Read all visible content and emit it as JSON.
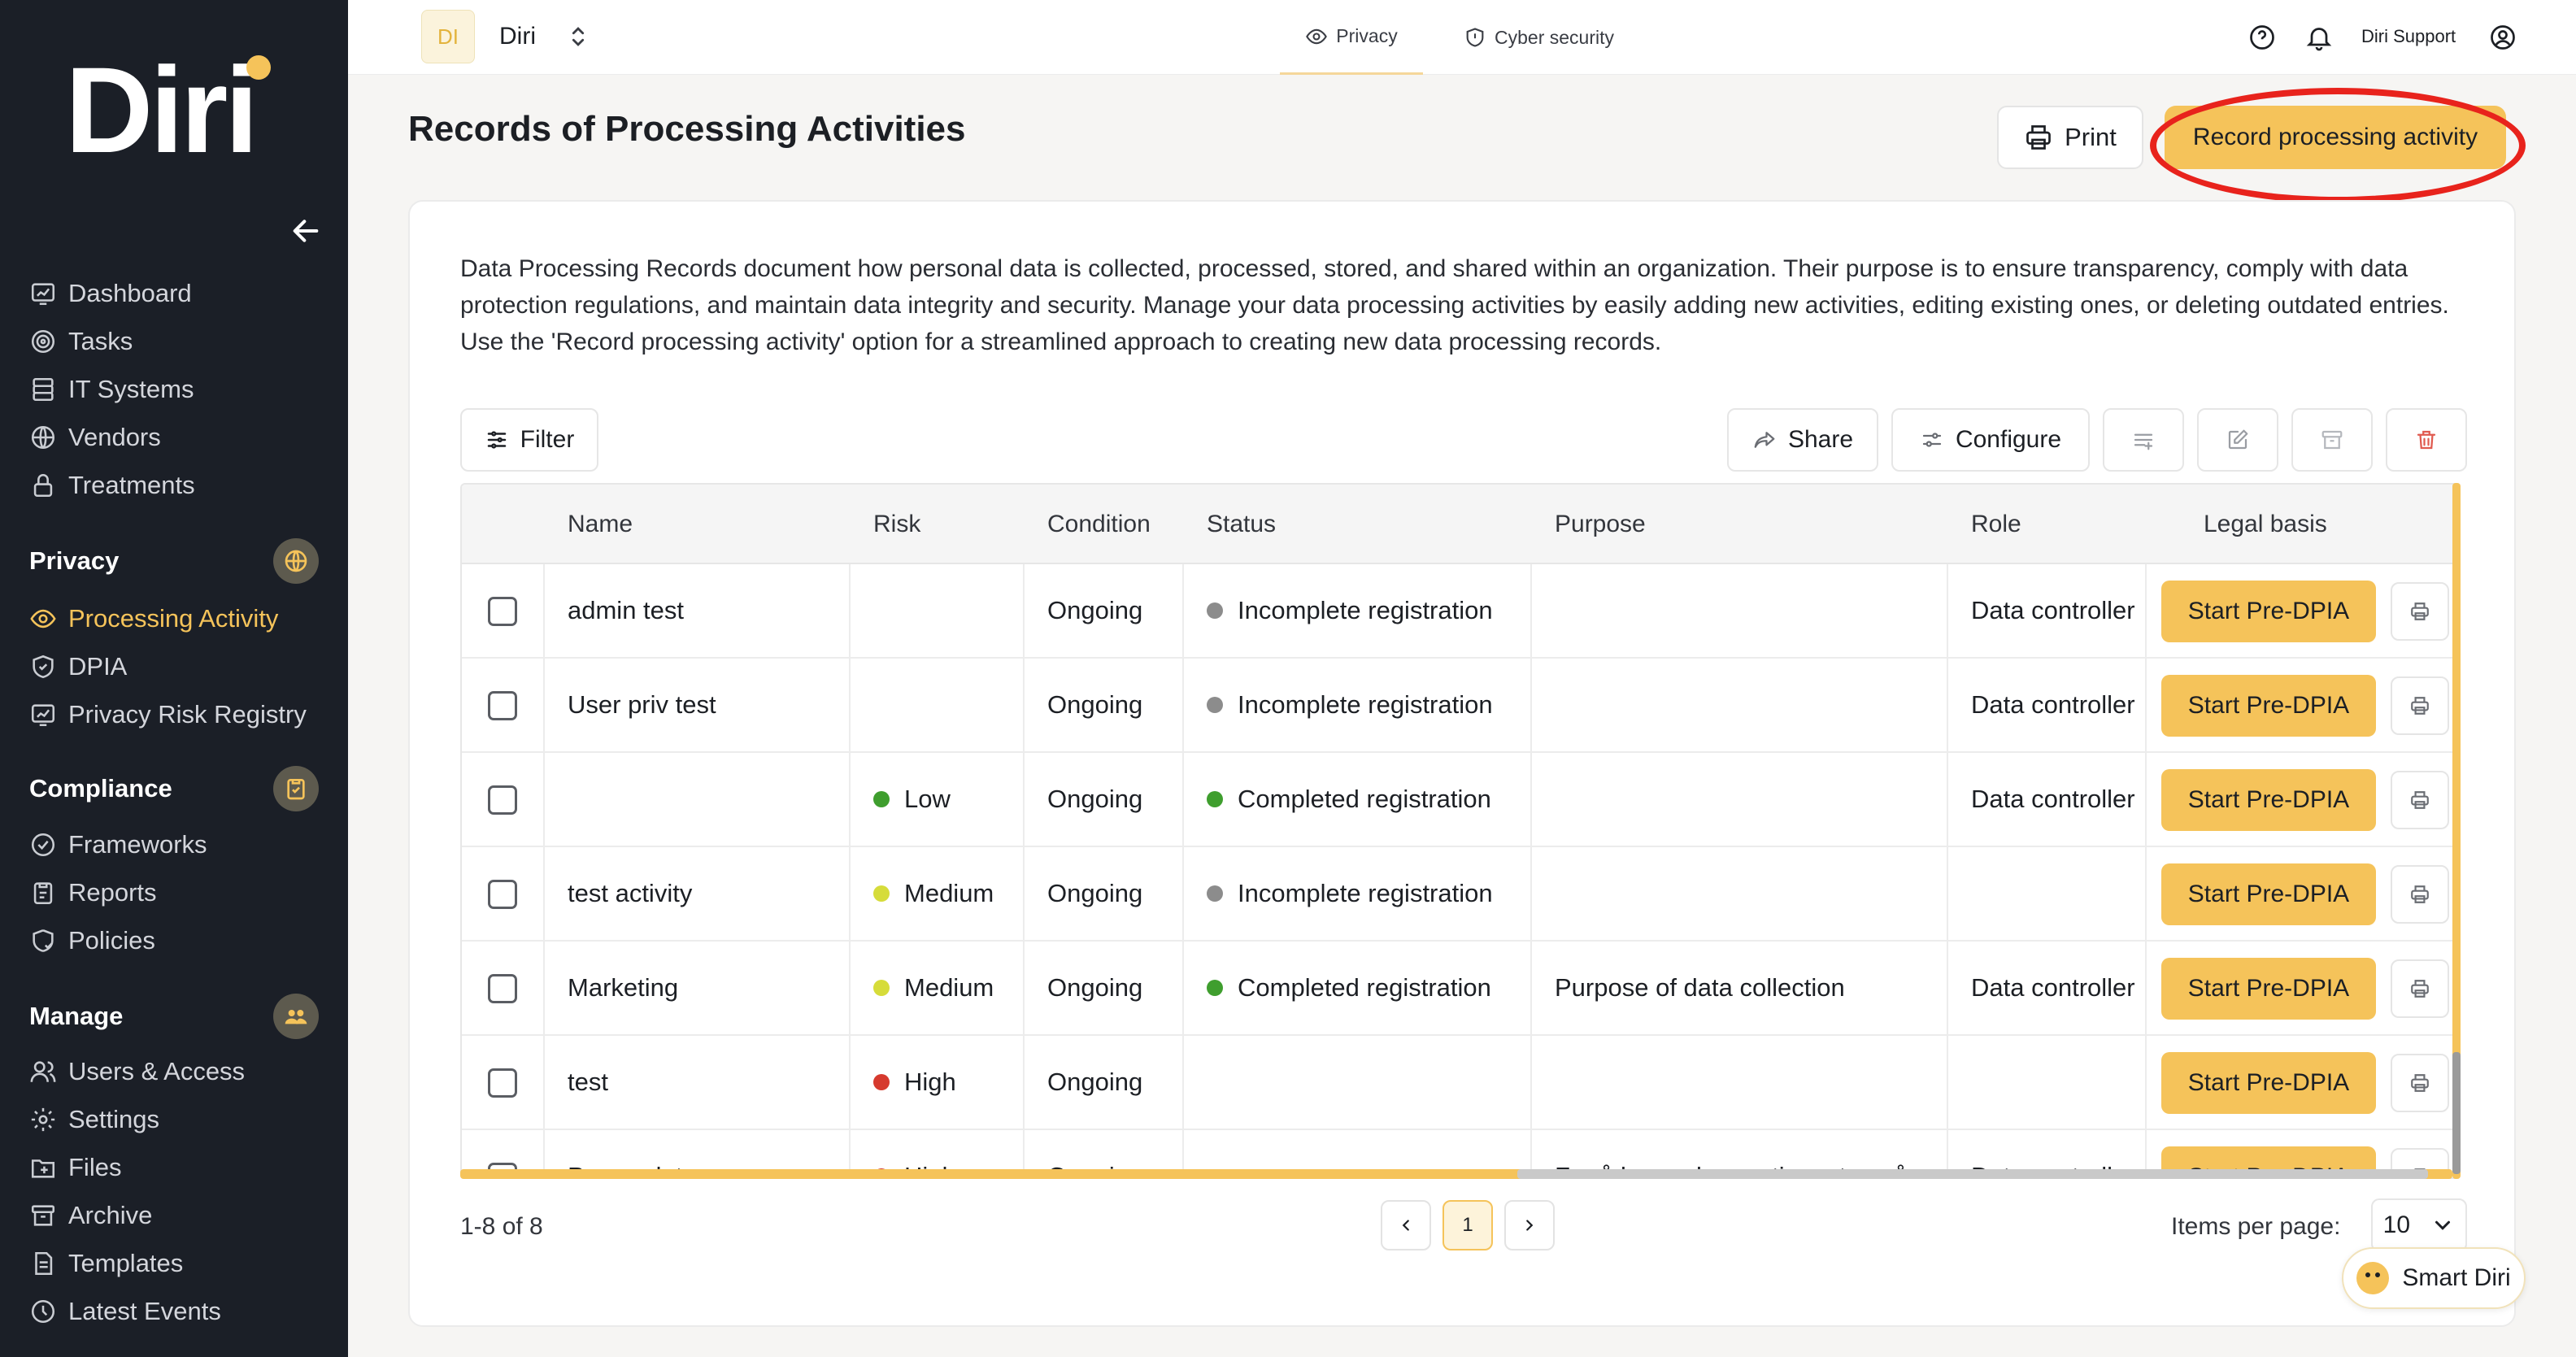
{
  "brand": {
    "logo": "Diri",
    "accent": "#f5c35a",
    "sidebar_bg": "#1b1f27"
  },
  "topbar": {
    "org_initials": "DI",
    "org_name": "Diri",
    "tabs": [
      {
        "label": "Privacy",
        "icon": "eye-icon",
        "active": true
      },
      {
        "label": "Cyber security",
        "icon": "shield-icon",
        "active": false
      }
    ],
    "user_name": "Diri Support"
  },
  "sidebar": {
    "top_items": [
      {
        "label": "Dashboard",
        "icon": "dashboard-icon"
      },
      {
        "label": "Tasks",
        "icon": "target-icon"
      },
      {
        "label": "IT Systems",
        "icon": "server-icon"
      },
      {
        "label": "Vendors",
        "icon": "globe-icon"
      },
      {
        "label": "Treatments",
        "icon": "lock-icon"
      }
    ],
    "privacy_section": "Privacy",
    "privacy_items": [
      {
        "label": "Processing Activity",
        "icon": "eye-icon",
        "active": true
      },
      {
        "label": "DPIA",
        "icon": "shield-icon"
      },
      {
        "label": "Privacy Risk Registry",
        "icon": "registry-icon"
      }
    ],
    "compliance_section": "Compliance",
    "compliance_items": [
      {
        "label": "Frameworks",
        "icon": "check-circle-icon"
      },
      {
        "label": "Reports",
        "icon": "clipboard-icon"
      },
      {
        "label": "Policies",
        "icon": "policy-icon"
      }
    ],
    "manage_section": "Manage",
    "manage_items": [
      {
        "label": "Users & Access",
        "icon": "users-icon"
      },
      {
        "label": "Settings",
        "icon": "gear-icon"
      },
      {
        "label": "Files",
        "icon": "files-icon"
      },
      {
        "label": "Archive",
        "icon": "archive-icon"
      },
      {
        "label": "Templates",
        "icon": "templates-icon"
      },
      {
        "label": "Latest Events",
        "icon": "clock-icon"
      }
    ]
  },
  "page": {
    "title": "Records of Processing Activities",
    "print_label": "Print",
    "record_label": "Record processing activity",
    "description": "Data Processing Records document how personal data is collected, processed, stored, and shared within an organization. Their purpose is to ensure transparency, comply with data protection regulations, and maintain data integrity and security. Manage your data processing activities by easily adding new activities, editing existing ones, or deleting outdated entries. Use the 'Record processing activity' option for a streamlined approach to creating new data processing records."
  },
  "toolbar": {
    "filter_label": "Filter",
    "share_label": "Share",
    "configure_label": "Configure"
  },
  "table": {
    "columns": [
      "Name",
      "Risk",
      "Condition",
      "Status",
      "Purpose",
      "Role",
      "Legal basis"
    ],
    "action_label": "Start Pre-DPIA",
    "rows": [
      {
        "name": "admin test",
        "risk": "",
        "risk_color": "",
        "condition": "Ongoing",
        "status": "Incomplete registration",
        "status_color": "#8c8c8c",
        "purpose": "",
        "role": "Data controller"
      },
      {
        "name": "User priv test",
        "risk": "",
        "risk_color": "",
        "condition": "Ongoing",
        "status": "Incomplete registration",
        "status_color": "#8c8c8c",
        "purpose": "",
        "role": "Data controller"
      },
      {
        "name": "",
        "risk": "Low",
        "risk_color": "#3f9e2e",
        "condition": "Ongoing",
        "status": "Completed registration",
        "status_color": "#3f9e2e",
        "purpose": "",
        "role": "Data controller"
      },
      {
        "name": "test activity",
        "risk": "Medium",
        "risk_color": "#d6dc3a",
        "condition": "Ongoing",
        "status": "Incomplete registration",
        "status_color": "#8c8c8c",
        "purpose": "",
        "role": ""
      },
      {
        "name": "Marketing",
        "risk": "Medium",
        "risk_color": "#d6dc3a",
        "condition": "Ongoing",
        "status": "Completed registration",
        "status_color": "#3f9e2e",
        "purpose": "Purpose of data collection",
        "role": "Data controller"
      },
      {
        "name": "test",
        "risk": "High",
        "risk_color": "#d63a2e",
        "condition": "Ongoing",
        "status": "",
        "status_color": "",
        "purpose": "",
        "role": ""
      },
      {
        "name": "Persondata",
        "risk": "High",
        "risk_color": "#d63a2e",
        "condition": "Ongoing",
        "status": "",
        "status_color": "",
        "purpose": "For å kunne levere tjenesten vår",
        "role": "Data controller"
      }
    ]
  },
  "pagination": {
    "range": "1-8 of 8",
    "current_page": "1",
    "items_per_page_label": "Items per page:",
    "items_per_page": "10"
  },
  "assistant": {
    "label": "Smart Diri"
  }
}
